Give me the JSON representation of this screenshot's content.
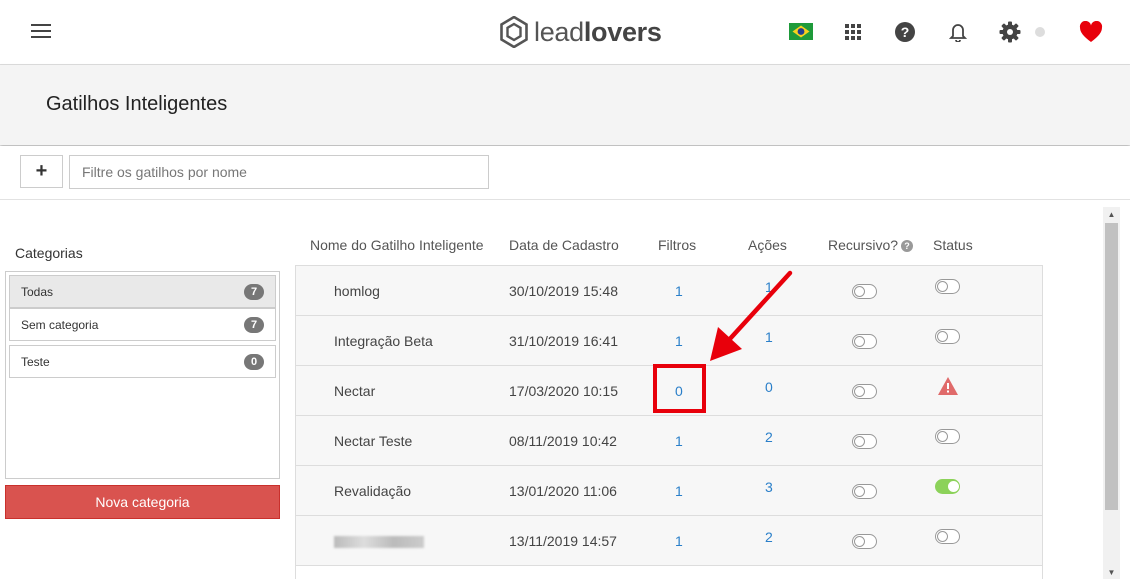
{
  "header": {
    "logo_light": "lead",
    "logo_bold": "lovers"
  },
  "page": {
    "title": "Gatilhos Inteligentes"
  },
  "toolbar": {
    "add_label": "+",
    "filter_placeholder": "Filtre os gatilhos por nome"
  },
  "categories": {
    "title": "Categorias",
    "items": [
      {
        "label": "Todas",
        "count": "7",
        "active": true
      },
      {
        "label": "Sem categoria",
        "count": "7",
        "active": false
      },
      {
        "label": "Teste",
        "count": "0",
        "active": false
      }
    ],
    "new_button": "Nova categoria"
  },
  "table": {
    "columns": {
      "name": "Nome do Gatilho Inteligente",
      "date": "Data de Cadastro",
      "filters": "Filtros",
      "actions": "Ações",
      "recursive": "Recursivo?",
      "status": "Status"
    },
    "rows": [
      {
        "name": "homlog",
        "date": "30/10/2019 15:48",
        "filters": "1",
        "actions": "1",
        "recursive": false,
        "status": "off"
      },
      {
        "name": "Integração Beta",
        "date": "31/10/2019 16:41",
        "filters": "1",
        "actions": "1",
        "recursive": false,
        "status": "off"
      },
      {
        "name": "Nectar",
        "date": "17/03/2020 10:15",
        "filters": "0",
        "actions": "0",
        "recursive": false,
        "status": "warning"
      },
      {
        "name": "Nectar Teste",
        "date": "08/11/2019 10:42",
        "filters": "1",
        "actions": "2",
        "recursive": false,
        "status": "off"
      },
      {
        "name": "Revalidação",
        "date": "13/01/2020 11:06",
        "filters": "1",
        "actions": "3",
        "recursive": false,
        "status": "on"
      },
      {
        "name": "",
        "date": "13/11/2019 14:57",
        "filters": "1",
        "actions": "2",
        "recursive": false,
        "status": "off"
      }
    ]
  },
  "colors": {
    "accent_red": "#d9534f",
    "link_blue": "#2a7fc9",
    "toggle_on": "#8cd25a",
    "annotation_red": "#e8000b"
  }
}
